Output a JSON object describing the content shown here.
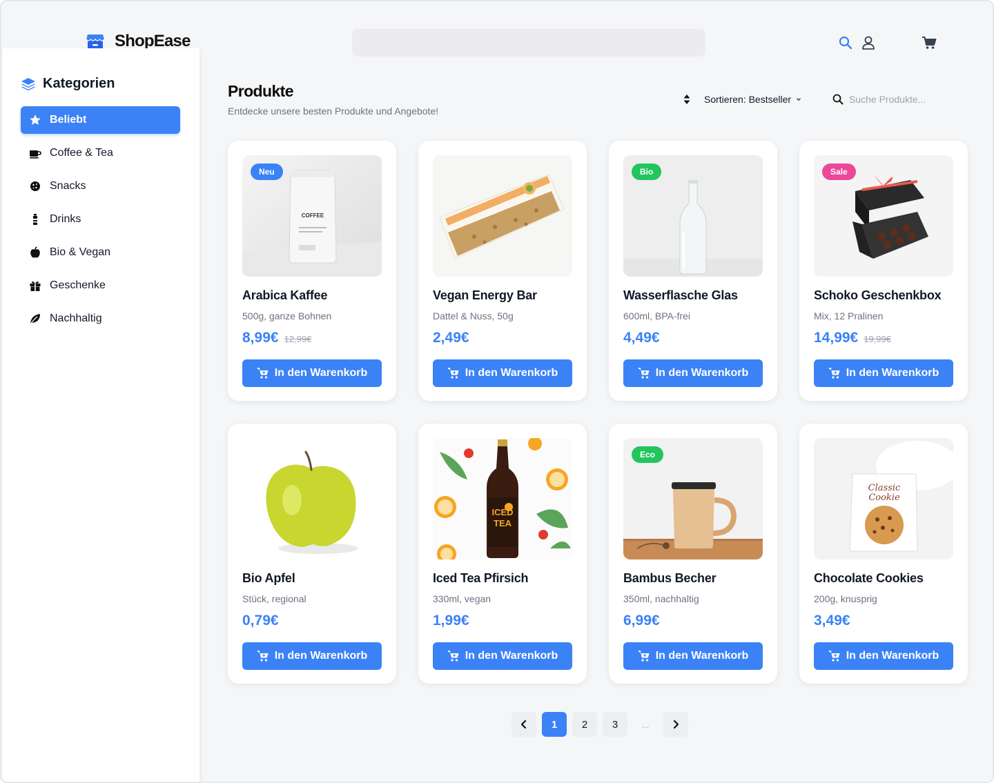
{
  "brand": {
    "name": "ShopEase"
  },
  "header": {
    "search_placeholder": ""
  },
  "sidebar": {
    "title": "Kategorien",
    "items": [
      {
        "label": "Beliebt",
        "icon": "star-icon",
        "active": true
      },
      {
        "label": "Coffee & Tea",
        "icon": "mug-icon",
        "active": false
      },
      {
        "label": "Snacks",
        "icon": "cookie-icon",
        "active": false
      },
      {
        "label": "Drinks",
        "icon": "bottle-icon",
        "active": false
      },
      {
        "label": "Bio & Vegan",
        "icon": "apple-icon",
        "active": false
      },
      {
        "label": "Geschenke",
        "icon": "gift-icon",
        "active": false
      },
      {
        "label": "Nachhaltig",
        "icon": "leaf-icon",
        "active": false
      }
    ]
  },
  "main": {
    "title": "Produkte",
    "subtitle": "Entdecke unsere besten Produkte und Angebote!",
    "sort_label": "Sortieren: Bestseller",
    "search_placeholder": "Suche Produkte..."
  },
  "cart_label": "In den Warenkorb",
  "products": [
    {
      "name": "Arabica Kaffee",
      "desc": "500g, ganze Bohnen",
      "price": "8,99€",
      "old_price": "12,99€",
      "badge": "Neu",
      "badge_color": "#3b82f6",
      "image": "coffee-bag"
    },
    {
      "name": "Vegan Energy Bar",
      "desc": "Dattel & Nuss, 50g",
      "price": "2,49€",
      "old_price": "",
      "badge": "",
      "badge_color": "",
      "image": "energy-bar"
    },
    {
      "name": "Wasserflasche Glas",
      "desc": "600ml, BPA-frei",
      "price": "4,49€",
      "old_price": "",
      "badge": "Bio",
      "badge_color": "#22c55e",
      "image": "glass-bottle"
    },
    {
      "name": "Schoko Geschenkbox",
      "desc": "Mix, 12 Pralinen",
      "price": "14,99€",
      "old_price": "19,99€",
      "badge": "Sale",
      "badge_color": "#ec4899",
      "image": "gift-box"
    },
    {
      "name": "Bio Apfel",
      "desc": "Stück, regional",
      "price": "0,79€",
      "old_price": "",
      "badge": "",
      "badge_color": "",
      "image": "apple"
    },
    {
      "name": "Iced Tea Pfirsich",
      "desc": "330ml, vegan",
      "price": "1,99€",
      "old_price": "",
      "badge": "",
      "badge_color": "",
      "image": "iced-tea",
      "image_text": [
        "ICED",
        "TEA"
      ]
    },
    {
      "name": "Bambus Becher",
      "desc": "350ml, nachhaltig",
      "price": "6,99€",
      "old_price": "",
      "badge": "Eco",
      "badge_color": "#22c55e",
      "image": "bamboo-mug"
    },
    {
      "name": "Chocolate Cookies",
      "desc": "200g, knusprig",
      "price": "3,49€",
      "old_price": "",
      "badge": "",
      "badge_color": "",
      "image": "cookie-bag",
      "image_text": [
        "Classic",
        "Cookie"
      ]
    }
  ],
  "pagination": {
    "pages": [
      "1",
      "2",
      "3"
    ],
    "current": "1",
    "ellipsis": "..."
  },
  "colors": {
    "accent": "#3b82f6",
    "green": "#22c55e",
    "pink": "#ec4899"
  }
}
